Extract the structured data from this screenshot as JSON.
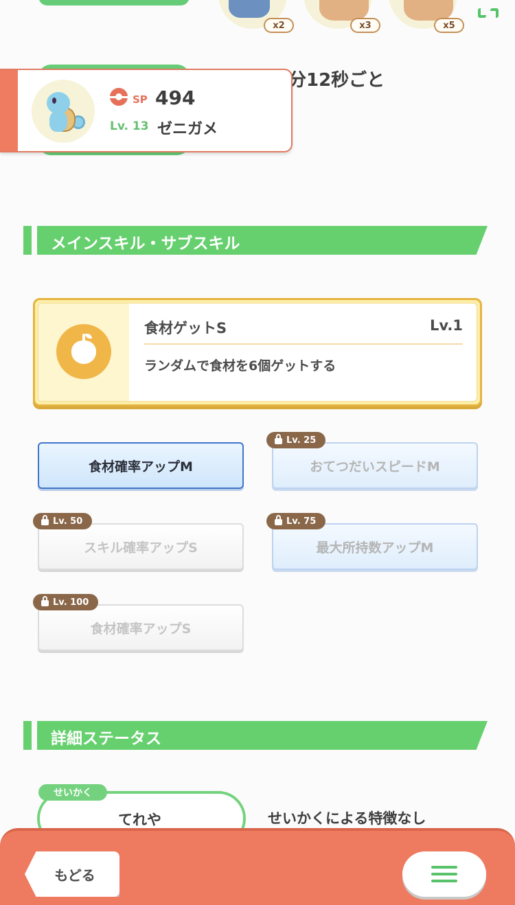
{
  "top": {
    "ingredient_quantities": [
      "x2",
      "x3",
      "x5"
    ],
    "help_frequency_text": "分12秒ごと"
  },
  "pokemon": {
    "sp_label": "SP",
    "sp_value": "494",
    "level_label": "Lv. 13",
    "name": "ゼニガメ"
  },
  "skills_section": {
    "title": "メインスキル・サブスキル",
    "main_skill": {
      "name": "食材ゲットS",
      "level": "Lv.1",
      "description": "ランダムで食材を6個ゲットする",
      "icon": "apple-icon"
    },
    "sub_skills": [
      {
        "label": "食材確率アップM",
        "lock_label": "",
        "state": "active"
      },
      {
        "label": "おてつだいスピードM",
        "lock_label": "Lv. 25",
        "state": "locked"
      },
      {
        "label": "スキル確率アップS",
        "lock_label": "Lv. 50",
        "state": "locked"
      },
      {
        "label": "最大所持数アップM",
        "lock_label": "Lv. 75",
        "state": "locked"
      },
      {
        "label": "食材確率アップS",
        "lock_label": "Lv. 100",
        "state": "locked"
      }
    ]
  },
  "status_section": {
    "title": "詳細ステータス",
    "nature_tag": "せいかく",
    "nature_value": "てれや",
    "nature_effect": "せいかくによる特徴なし"
  },
  "bottom_bar": {
    "back_label": "もどる",
    "menu_icon": "hamburger-menu-icon"
  },
  "colors": {
    "accent_green": "#66d06f",
    "accent_orange": "#ee7b60",
    "skill_gold": "#e4b440",
    "active_blue": "#3f75c9",
    "lock_brown": "#8a6749"
  }
}
